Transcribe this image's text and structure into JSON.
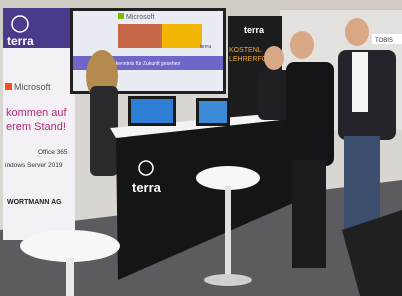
{
  "left_banner": {
    "brand": "terra",
    "microsoft": "Microsoft",
    "slogan_line1": "kommen auf",
    "slogan_line2": "erem Stand!",
    "product1": "Office 365",
    "product2": "indows Server 2019",
    "company": "WORTMANN AG"
  },
  "screen": {
    "microsoft": "Microsoft",
    "caption": "Mit Terra Erkenntnis für Zukunft gesehen",
    "brand": "terra"
  },
  "right_banner": {
    "brand": "terra",
    "line1": "KOSTENL",
    "line2": "LEHRERFORT"
  },
  "counter": {
    "brand": "terra"
  },
  "background": {
    "sign": "TOBIS"
  },
  "colors": {
    "terra_purple": "#4a3a8c",
    "banner_bg": "#f3f0f6",
    "counter_black": "#151515",
    "floor": "#5b5b60"
  }
}
